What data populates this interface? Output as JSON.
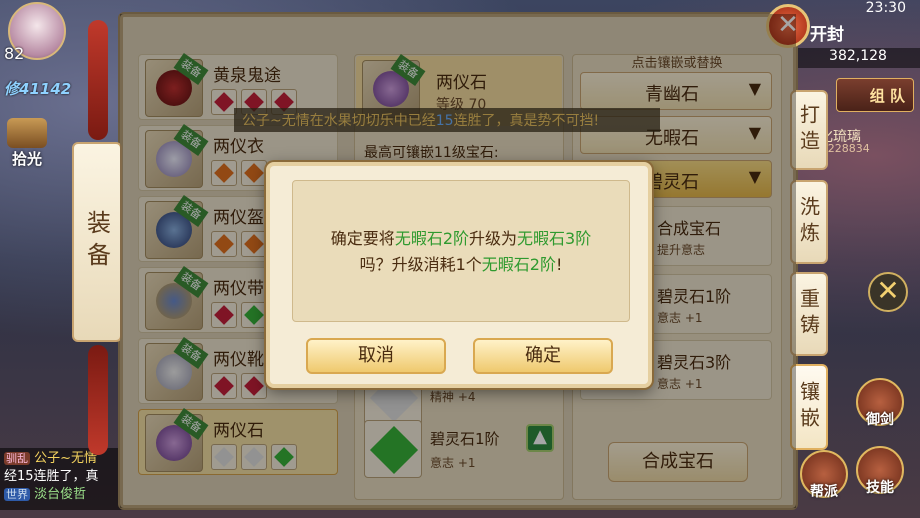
{
  "hud": {
    "level": "82",
    "power": "41142",
    "pickup_label": "拾光",
    "time": "23:30",
    "map_name": "开封",
    "coords": "382,128",
    "team_label": "组 队",
    "target_name": "羽化琉璃",
    "target_hp": "34/228834",
    "skill_sword": "御剑",
    "skill_skill": "技能",
    "skill_faction": "帮派"
  },
  "chat": {
    "line1_tag": "驯乱",
    "line1_name": "公子~无情",
    "line2": "经15连胜了，真",
    "line3_tag": "世界",
    "line3_text": "淡台俊哲"
  },
  "broadcast": {
    "prefix": "公子~无情在水果切切乐中已经",
    "num": "15",
    "suffix": "连胜了，真是势不可挡!"
  },
  "left_tab": "装备",
  "equipment": [
    {
      "name": "黄泉鬼途",
      "badge": "装备",
      "gems": [
        "red",
        "red",
        "red"
      ]
    },
    {
      "name": "两仪衣",
      "badge": "装备",
      "gems": [
        "orange",
        "orange"
      ]
    },
    {
      "name": "两仪盔",
      "badge": "装备",
      "gems": [
        "orange",
        "orange"
      ]
    },
    {
      "name": "两仪带",
      "badge": "装备",
      "gems": [
        "red",
        "green"
      ]
    },
    {
      "name": "两仪靴",
      "badge": "装备",
      "gems": [
        "red",
        "red"
      ]
    },
    {
      "name": "两仪石",
      "badge": "装备",
      "gems": [
        "white",
        "white",
        "green"
      ]
    }
  ],
  "middle": {
    "item_name": "两仪石",
    "item_badge": "装备",
    "item_level": "等级 70",
    "max_gem": "最高可镶嵌11级宝石:",
    "row1_stat": "精神 +4",
    "row2_name": "碧灵石1阶",
    "row2_stat": "意志 +1"
  },
  "right": {
    "hint": "点击镶嵌或替换",
    "dropdowns": [
      "青幽石",
      "无暇石",
      "碧灵石"
    ],
    "rows": [
      {
        "name": "合成宝石",
        "stat": "提升意志"
      },
      {
        "name": "碧灵石1阶",
        "stat": "意志 +1"
      },
      {
        "name": "碧灵石3阶",
        "stat": "意志 +1"
      }
    ],
    "compose_button": "合成宝石"
  },
  "side_tabs": [
    "打造",
    "洗炼",
    "重铸",
    "镶嵌"
  ],
  "dialog": {
    "text_1": "确定要将",
    "gem_from": "无暇石2阶",
    "text_2": "升级为",
    "gem_to": "无暇石3阶",
    "text_3": "吗？升级消耗1个",
    "gem_cost": "无暇石2阶",
    "text_4": "!",
    "cancel": "取消",
    "confirm": "确定"
  },
  "colors": {
    "highlight_green": "#2f9a2f",
    "panel_bg": "#dcd0b6",
    "button_gold": "#efc96e"
  }
}
